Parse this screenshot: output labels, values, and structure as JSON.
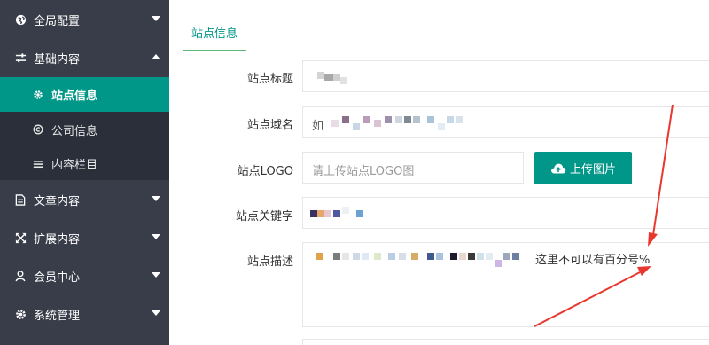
{
  "sidebar": {
    "items": [
      {
        "label": "全局配置",
        "icon": "globe-icon",
        "expanded": false
      },
      {
        "label": "基础内容",
        "icon": "sliders-icon",
        "expanded": true
      },
      {
        "label": "文章内容",
        "icon": "document-icon",
        "expanded": false
      },
      {
        "label": "扩展内容",
        "icon": "expand-arrows-icon",
        "expanded": false
      },
      {
        "label": "会员中心",
        "icon": "user-icon",
        "expanded": false
      },
      {
        "label": "系统管理",
        "icon": "gear-icon",
        "expanded": false
      }
    ],
    "subitems": [
      {
        "label": "站点信息",
        "icon": "gear-icon",
        "active": true
      },
      {
        "label": "公司信息",
        "icon": "copyright-icon",
        "active": false
      },
      {
        "label": "内容栏目",
        "icon": "menu-icon",
        "active": false
      }
    ]
  },
  "tabs": [
    {
      "label": "站点信息",
      "active": true
    }
  ],
  "form": {
    "title_label": "站点标题",
    "domain_label": "站点域名",
    "domain_value_prefix": "如",
    "logo_label": "站点LOGO",
    "logo_placeholder": "请上传站点LOGO图",
    "upload_button": "上传图片",
    "keywords_label": "站点关键字",
    "description_label": "站点描述",
    "description_visible_text": "这里不可以有百分号%"
  },
  "colors": {
    "sidebar_bg": "#393D49",
    "active_bg": "#009688",
    "accent": "#009688",
    "annotation_red": "#e8372f"
  }
}
